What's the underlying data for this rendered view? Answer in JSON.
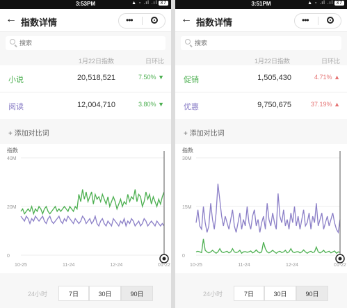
{
  "screens": [
    {
      "status": {
        "left": "",
        "time": "3:53PM",
        "battery": "37",
        "right_icons": "▲ ◦ .ıl .ıl"
      },
      "nav": {
        "back": "←",
        "title": "指数详情",
        "more": "•••"
      },
      "search": {
        "placeholder": "搜索"
      },
      "table": {
        "date_label": "1月22日指数",
        "change_label": "日环比",
        "rows": [
          {
            "name": "小说",
            "value": "20,518,521",
            "change": "7.50%",
            "arrow": "▼",
            "color": "#4caf50",
            "change_color": "#4caf50"
          },
          {
            "name": "阅读",
            "value": "12,004,710",
            "change": "3.80%",
            "arrow": "▼",
            "color": "#8b7fc7",
            "change_color": "#4caf50"
          }
        ]
      },
      "add_label": "+ 添加对比词",
      "chart_data": {
        "type": "line",
        "ylabel": "指数",
        "y_ticks": [
          "40M",
          "20M",
          "0"
        ],
        "ylim": [
          0,
          40000000
        ],
        "x_ticks": [
          "10-25",
          "11-24",
          "12-24",
          "01-22"
        ],
        "series": [
          {
            "name": "小说",
            "color": "#4caf50",
            "values": [
              18,
              19,
              17,
              18,
              19,
              18,
              20,
              17,
              19,
              18,
              20,
              19,
              17,
              19,
              20,
              18,
              17,
              18,
              19,
              20,
              18,
              19,
              18,
              19,
              20,
              19,
              18,
              20,
              19,
              18,
              20,
              19,
              25,
              22,
              27,
              23,
              26,
              22,
              24,
              26,
              21,
              25,
              23,
              24,
              22,
              25,
              23,
              21,
              24,
              20,
              22,
              24,
              22,
              19,
              21,
              23,
              20,
              22,
              21,
              25,
              22,
              24,
              23,
              27,
              22,
              25,
              24,
              20,
              22,
              26,
              23,
              25,
              21,
              24,
              22,
              20,
              23,
              21,
              24,
              26
            ]
          },
          {
            "name": "阅读",
            "color": "#8b7fc7",
            "values": [
              16,
              15,
              14,
              16,
              15,
              13,
              15,
              14,
              16,
              15,
              14,
              15,
              16,
              14,
              13,
              15,
              16,
              14,
              13,
              14,
              15,
              16,
              14,
              13,
              15,
              14,
              16,
              15,
              14,
              13,
              15,
              14,
              13,
              14,
              16,
              15,
              13,
              14,
              15,
              13,
              14,
              16,
              13,
              12,
              14,
              15,
              13,
              12,
              14,
              13,
              12,
              15,
              14,
              13,
              12,
              14,
              13,
              15,
              12,
              14,
              13,
              15,
              14,
              12,
              13,
              14,
              12,
              13,
              15,
              14,
              12,
              13,
              14,
              13,
              12,
              14,
              13,
              12,
              13,
              12
            ]
          }
        ]
      },
      "tabs": [
        {
          "label": "24小时",
          "state": "disabled"
        },
        {
          "label": "7日",
          "state": "normal"
        },
        {
          "label": "30日",
          "state": "normal"
        },
        {
          "label": "90日",
          "state": "active"
        }
      ]
    },
    {
      "status": {
        "left": "",
        "time": "3:51PM",
        "battery": "37",
        "right_icons": "▲ ◦ .ıl .ıl"
      },
      "nav": {
        "back": "←",
        "title": "指数详情",
        "more": "•••"
      },
      "search": {
        "placeholder": "搜索"
      },
      "table": {
        "date_label": "1月22日指数",
        "change_label": "日环比",
        "rows": [
          {
            "name": "促销",
            "value": "1,505,430",
            "change": "4.71%",
            "arrow": "▲",
            "color": "#4caf50",
            "change_color": "#e57373"
          },
          {
            "name": "优惠",
            "value": "9,750,675",
            "change": "37.19%",
            "arrow": "▲",
            "color": "#8b7fc7",
            "change_color": "#e57373"
          }
        ]
      },
      "add_label": "+ 添加对比词",
      "chart_data": {
        "type": "line",
        "ylabel": "指数",
        "y_ticks": [
          "30M",
          "15M",
          "0"
        ],
        "ylim": [
          0,
          30000000
        ],
        "x_ticks": [
          "10-25",
          "11-24",
          "12-24",
          "01-22"
        ],
        "series": [
          {
            "name": "促销",
            "color": "#4caf50",
            "values": [
              1,
              1.2,
              1,
              0.8,
              5,
              1.5,
              1,
              0.7,
              1,
              1.5,
              1,
              0.6,
              1,
              2,
              1,
              0.8,
              1,
              1.2,
              0.7,
              1,
              2,
              1,
              0.8,
              1,
              1.5,
              0.6,
              1,
              1.1,
              0.9,
              1,
              1.3,
              0.7,
              1,
              1.6,
              1,
              0.7,
              1,
              4,
              2,
              1,
              0.7,
              1,
              1.5,
              1,
              0.6,
              1,
              1.2,
              0.8,
              1,
              1.5,
              0.7,
              1,
              2,
              1,
              0.8,
              1,
              1.1,
              0.7,
              1,
              1.6,
              1,
              0.6,
              1,
              1.2,
              0.8,
              1,
              2.5,
              1,
              0.7,
              1,
              1.5,
              0.8,
              1,
              1.2,
              0.7,
              1,
              1.3,
              0.6,
              1,
              0.9
            ]
          },
          {
            "name": "优惠",
            "color": "#8b7fc7",
            "values": [
              10,
              14,
              9,
              8,
              15,
              10,
              7,
              9,
              16,
              11,
              8,
              13,
              22,
              17,
              12,
              9,
              12,
              10,
              8,
              11,
              14,
              9,
              7,
              10,
              13,
              8,
              11,
              9,
              15,
              10,
              8,
              12,
              14,
              9,
              11,
              7,
              10,
              12,
              8,
              16,
              11,
              9,
              13,
              10,
              8,
              19,
              12,
              10,
              14,
              9,
              11,
              8,
              13,
              10,
              15,
              9,
              12,
              8,
              11,
              14,
              9,
              10,
              13,
              8,
              12,
              10,
              16,
              9,
              11,
              13,
              8,
              10,
              12,
              9,
              11,
              13,
              10,
              8,
              7,
              11
            ]
          }
        ]
      },
      "tabs": [
        {
          "label": "24小时",
          "state": "disabled"
        },
        {
          "label": "7日",
          "state": "normal"
        },
        {
          "label": "30日",
          "state": "normal"
        },
        {
          "label": "90日",
          "state": "active"
        }
      ]
    }
  ]
}
